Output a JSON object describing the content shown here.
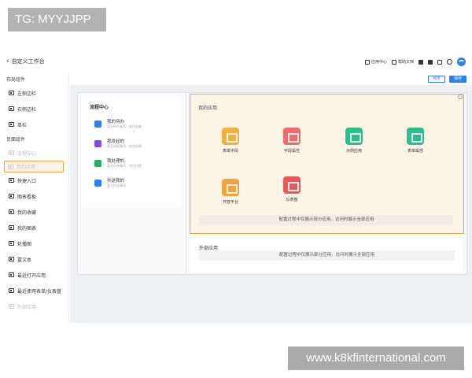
{
  "watermarks": {
    "top": "TG: MYYJJPP",
    "bottom": "www.k8kfinternational.com"
  },
  "header": {
    "title": "自定义工作台",
    "tools": {
      "app_center": "应用中心",
      "help_docs": "帮助文档"
    },
    "preview_label": "预览",
    "save_label": "保存"
  },
  "sidebar": {
    "layout_section": "布局组件",
    "layout_items": [
      "左侧边栏",
      "右侧边栏",
      "单栏"
    ],
    "page_section": "页面组件",
    "page_items": [
      "流程中心",
      "我的应用",
      "快捷入口",
      "图表看板",
      "我的收藏",
      "我的图表",
      "轮播图",
      "富文本",
      "最近打开应用",
      "最近使用表单/仪表盘",
      "外部应用"
    ]
  },
  "flow_center": {
    "title": "流程中心",
    "items": [
      {
        "name": "我的待办",
        "desc": "暂无待办事项，前往创建",
        "color": "#2f80ed"
      },
      {
        "name": "我发起的",
        "desc": "暂无发起事项，前往创建",
        "color": "#7a4fd6"
      },
      {
        "name": "我处理的",
        "desc": "暂无处理事项，前往创建",
        "color": "#27ae60"
      },
      {
        "name": "抄送我的",
        "desc": "暂无抄送事项",
        "color": "#2f80ed"
      }
    ]
  },
  "my_apps": {
    "title": "我的应用",
    "apps": [
      {
        "label": "表单字段",
        "color": "#f2b03d"
      },
      {
        "label": "字段属性",
        "color": "#ef6a6a"
      },
      {
        "label": "示例应用",
        "color": "#2dbf8a"
      },
      {
        "label": "表单属性",
        "color": "#2dbf8a"
      },
      {
        "label": "开放平台",
        "color": "#f2a33a"
      },
      {
        "label": "仪表盘",
        "color": "#e85a5a"
      }
    ],
    "notice": "配置过程中仅展示部分应用，访问时展示全部应用"
  },
  "external_apps": {
    "title": "外部应用",
    "notice": "配置过程中仅展示部分应用，访问时展示全部应用"
  }
}
